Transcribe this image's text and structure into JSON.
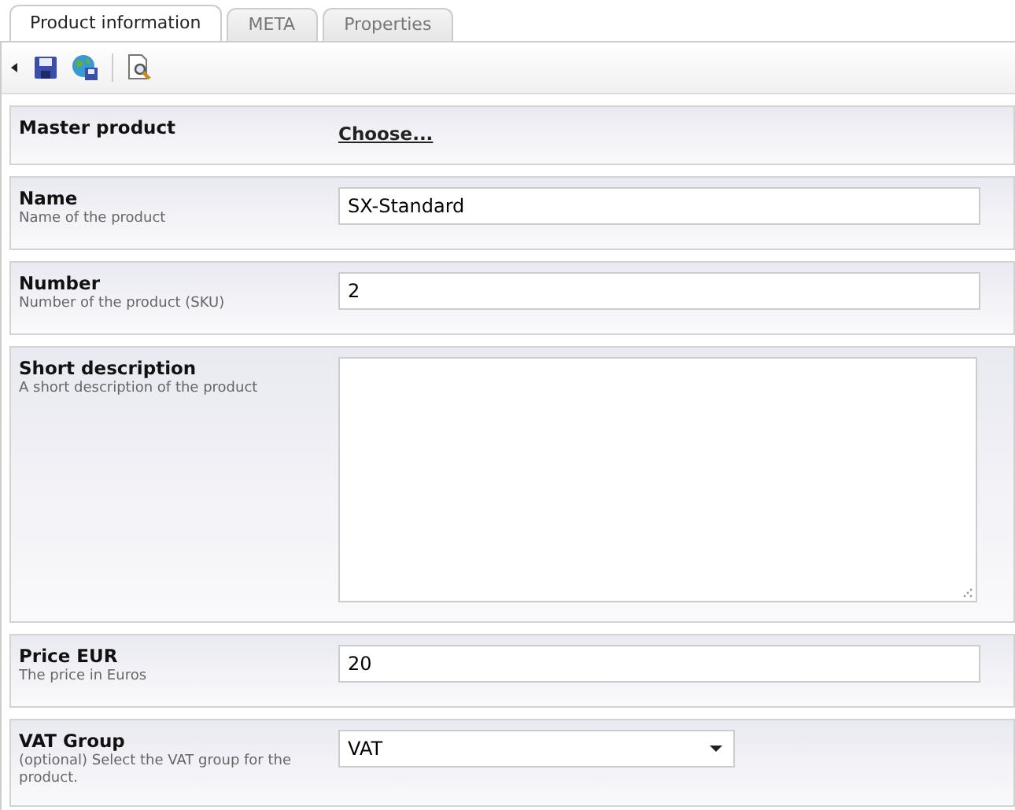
{
  "tabs": [
    {
      "label": "Product information",
      "selected": true
    },
    {
      "label": "META",
      "selected": false
    },
    {
      "label": "Properties",
      "selected": false
    }
  ],
  "fields": [
    {
      "kind": "link",
      "label": "Master product",
      "value": "Choose..."
    },
    {
      "kind": "text",
      "label": "Name",
      "hint": "Name of the product",
      "value": "SX-Standard"
    },
    {
      "kind": "text",
      "label": "Number",
      "hint": "Number of the product (SKU)",
      "value": "2"
    },
    {
      "kind": "textarea",
      "label": "Short description",
      "hint": "A short description of the product"
    },
    {
      "kind": "text",
      "label": "Price EUR",
      "hint": "The price in Euros",
      "value": "20"
    },
    {
      "kind": "select",
      "label": "VAT Group",
      "hint": "(optional) Select the VAT group for the product.",
      "value": "VAT"
    }
  ]
}
